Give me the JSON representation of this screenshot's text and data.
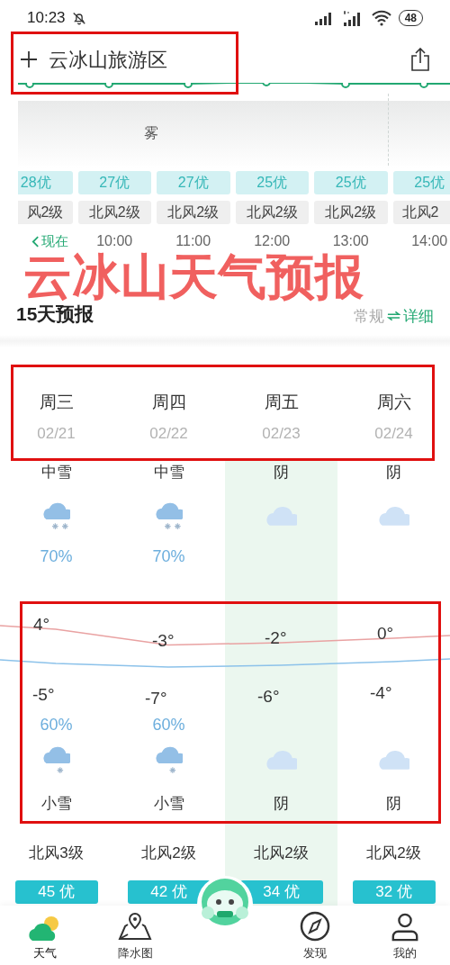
{
  "status_bar": {
    "time": "10:23",
    "battery": "48"
  },
  "header": {
    "location": "云冰山旅游区"
  },
  "hourly": {
    "weather_label": "雾",
    "aqi": [
      "28优",
      "27优",
      "27优",
      "25优",
      "25优",
      "25优"
    ],
    "wind": [
      "风2级",
      "北风2级",
      "北风2级",
      "北风2级",
      "北风2级",
      "北风2"
    ],
    "times": [
      "现在",
      "10:00",
      "11:00",
      "12:00",
      "13:00",
      "14:00"
    ]
  },
  "overlay_title": "云冰山天气预报",
  "forecast": {
    "title": "15天预报",
    "modes": [
      {
        "label": "常规",
        "selected": false
      },
      {
        "label": "详细",
        "selected": true
      }
    ]
  },
  "days": [
    {
      "weekday": "周三",
      "date": "02/21",
      "day": {
        "kind": "snow",
        "weather": "中雪",
        "precip": "70%"
      },
      "high": "4°",
      "low": "-5°",
      "night": {
        "kind": "snow",
        "weather": "小雪",
        "precip": "60%"
      },
      "wind": "北风3级",
      "aqi": "45 优",
      "highlighted": false
    },
    {
      "weekday": "周四",
      "date": "02/22",
      "day": {
        "kind": "snow",
        "weather": "中雪",
        "precip": "70%"
      },
      "high": "-3°",
      "low": "-7°",
      "night": {
        "kind": "snow",
        "weather": "小雪",
        "precip": "60%"
      },
      "wind": "北风2级",
      "aqi": "42 优",
      "highlighted": false
    },
    {
      "weekday": "周五",
      "date": "02/23",
      "day": {
        "kind": "cloudy",
        "weather": "阴"
      },
      "high": "-2°",
      "low": "-6°",
      "night": {
        "kind": "cloudy",
        "weather": "阴"
      },
      "wind": "北风2级",
      "aqi": "34 优",
      "highlighted": true
    },
    {
      "weekday": "周六",
      "date": "02/24",
      "day": {
        "kind": "cloudy",
        "weather": "阴"
      },
      "high": "0°",
      "low": "-4°",
      "night": {
        "kind": "cloudy",
        "weather": "阴"
      },
      "wind": "北风2级",
      "aqi": "32 优",
      "highlighted": false
    }
  ],
  "tabs": [
    {
      "label": "天气",
      "selected": true
    },
    {
      "label": "降水图",
      "selected": false
    },
    {
      "selected": false
    },
    {
      "label": "发现",
      "selected": false
    },
    {
      "label": "我的",
      "selected": false
    }
  ]
}
